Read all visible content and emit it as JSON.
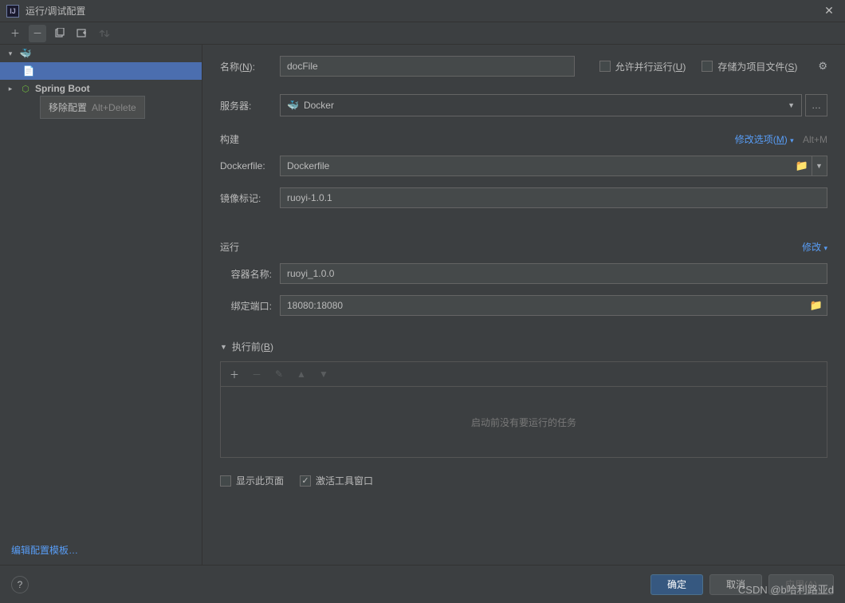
{
  "titlebar": {
    "title": "运行/调试配置"
  },
  "tooltip": {
    "text": "移除配置",
    "shortcut": "Alt+Delete"
  },
  "sidebar": {
    "docker_item": "",
    "spring_item": "Spring Boot",
    "edit_templates": "编辑配置模板…"
  },
  "form": {
    "name_label": "名称(<u>N</u>):",
    "name_value": "docFile",
    "allow_parallel": "允许并行运行(<u>U</u>)",
    "save_as_project": "存储为项目文件(<u>S</u>)",
    "server_label": "服务器:",
    "server_value": "Docker",
    "build_section": "构建",
    "modify_options": "修改选项(<u>M</u>)",
    "modify_shortcut": "Alt+M",
    "dockerfile_label": "Dockerfile:",
    "dockerfile_value": "Dockerfile",
    "image_tag_label": "镜像标记:",
    "image_tag_value": "ruoyi-1.0.1",
    "run_section": "运行",
    "modify_link": "修改",
    "container_name_label": "容器名称:",
    "container_name_value": "ruoyi_1.0.0",
    "bind_ports_label": "绑定端口:",
    "bind_ports_value": "18080:18080",
    "before_launch": "执行前(<u>B</u>)",
    "empty_tasks": "启动前没有要运行的任务",
    "show_page": "显示此页面",
    "activate_tool": "激活工具窗口"
  },
  "footer": {
    "ok": "确定",
    "cancel": "取消",
    "apply": "应用(A)"
  },
  "watermark": "CSDN @b哈利路亚d"
}
